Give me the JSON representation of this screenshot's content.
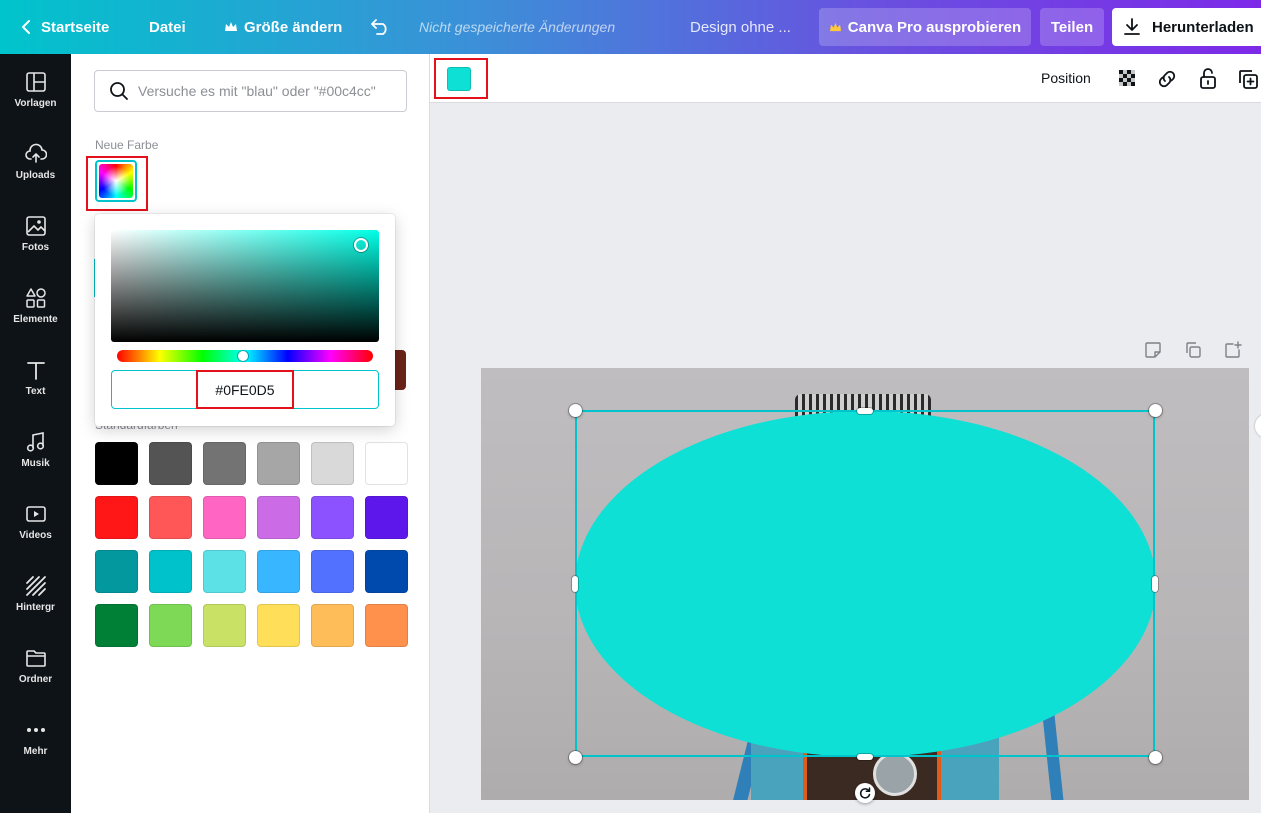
{
  "topbar": {
    "home": "Startseite",
    "file": "Datei",
    "resize": "Größe ändern",
    "unsaved": "Nicht gespeicherte Änderungen",
    "design_title": "Design ohne ...",
    "try_pro": "Canva Pro ausprobieren",
    "share": "Teilen",
    "download": "Herunterladen"
  },
  "rail": [
    {
      "label": "Vorlagen",
      "icon": "templates-icon"
    },
    {
      "label": "Uploads",
      "icon": "upload-cloud-icon"
    },
    {
      "label": "Fotos",
      "icon": "photos-icon"
    },
    {
      "label": "Elemente",
      "icon": "elements-icon"
    },
    {
      "label": "Text",
      "icon": "text-icon"
    },
    {
      "label": "Musik",
      "icon": "music-icon"
    },
    {
      "label": "Videos",
      "icon": "video-icon"
    },
    {
      "label": "Hintergr",
      "icon": "background-icon"
    },
    {
      "label": "Ordner",
      "icon": "folder-icon"
    },
    {
      "label": "Mehr",
      "icon": "more-icon"
    }
  ],
  "panel": {
    "search_placeholder": "Versuche es mit \"blau\" oder \"#00c4cc\"",
    "new_color_label": "Neue Farbe",
    "standard_colors_label": "Standardfarben",
    "picker": {
      "hex_value": "#0FE0D5",
      "hue_position": 0.49,
      "saturation": 0.93,
      "brightness": 0.88
    },
    "standard_colors": [
      [
        "#000000",
        "#545454",
        "#737373",
        "#a6a6a6",
        "#d9d9d9",
        "#ffffff"
      ],
      [
        "#ff1616",
        "#ff5757",
        "#ff66c4",
        "#cb6ce6",
        "#8c52ff",
        "#5e17eb"
      ],
      [
        "#03989e",
        "#00c2cb",
        "#5ce1e6",
        "#38b6ff",
        "#5271ff",
        "#004aad"
      ],
      [
        "#008037",
        "#7ed957",
        "#c9e265",
        "#ffde59",
        "#ffbd59",
        "#ff914d"
      ]
    ]
  },
  "canvas_toolbar": {
    "fill_color": "#0FE0D5",
    "position_label": "Position"
  },
  "design": {
    "shape_fill": "#0FE0D5"
  }
}
